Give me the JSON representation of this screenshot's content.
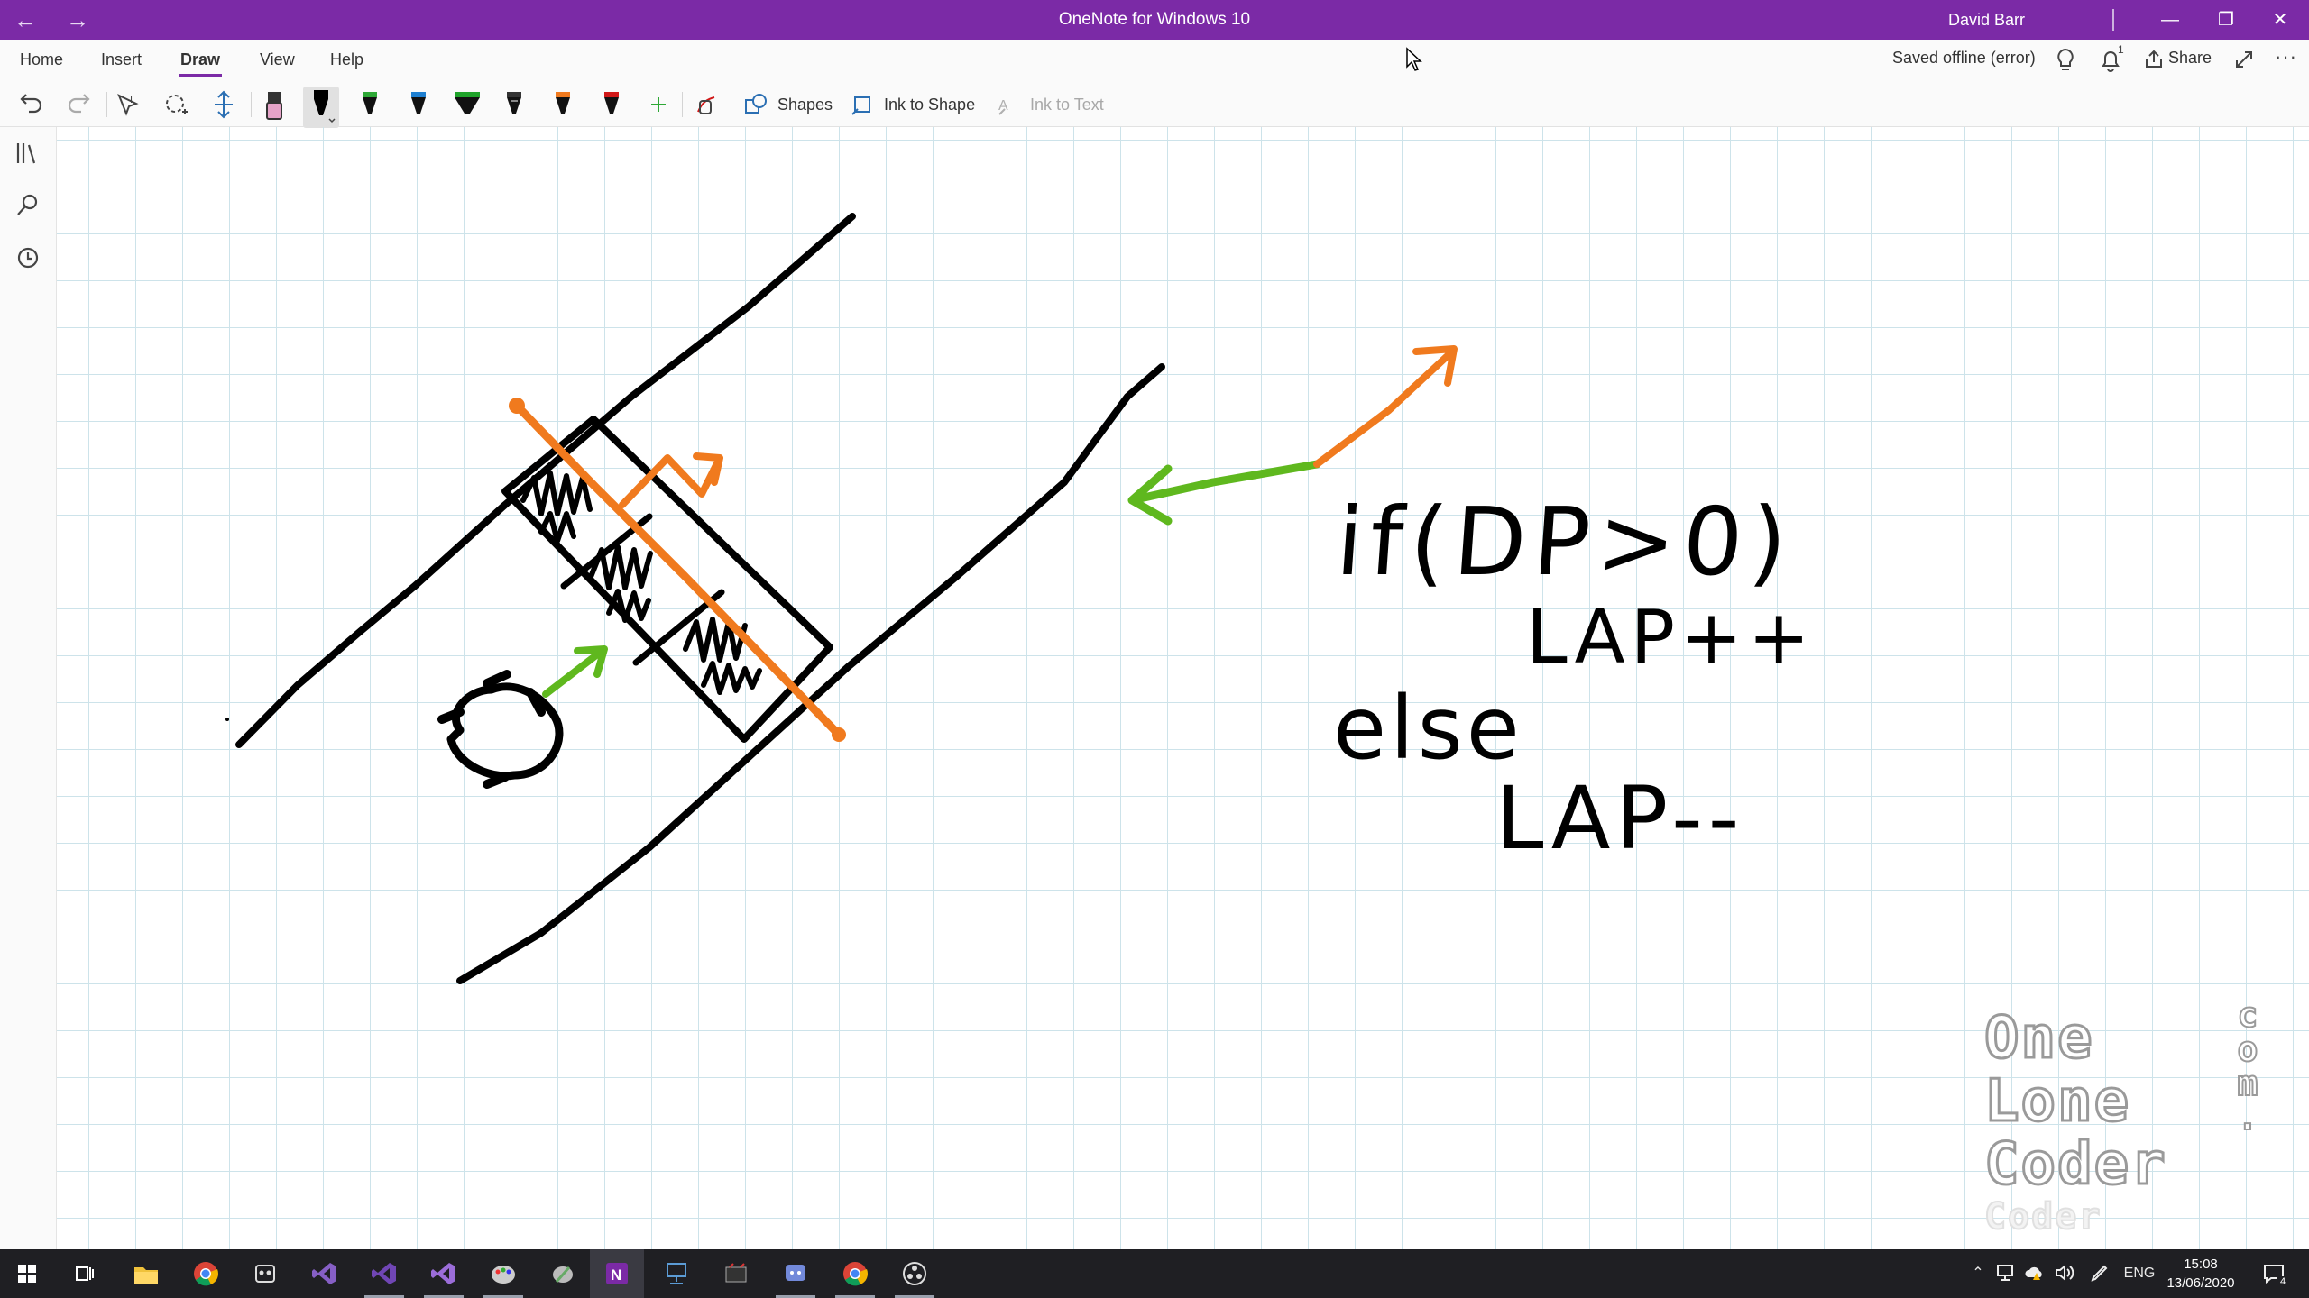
{
  "window": {
    "title": "OneNote for Windows 10",
    "user": "David Barr",
    "back_glyph": "←",
    "forward_glyph": "→",
    "minimize_glyph": "—",
    "restore_glyph": "❐",
    "close_glyph": "✕"
  },
  "menu": {
    "tabs": [
      {
        "label": "Home"
      },
      {
        "label": "Insert"
      },
      {
        "label": "Draw",
        "active": true
      },
      {
        "label": "View"
      },
      {
        "label": "Help"
      }
    ],
    "status": "Saved offline (error)",
    "notification_count": "1",
    "share_label": "Share"
  },
  "toolbar": {
    "shapes_label": "Shapes",
    "ink_to_shape_label": "Ink to Shape",
    "ink_to_text_label": "Ink to Text",
    "pen_colors": [
      "#e5a3c8",
      "#000000",
      "#2ea836",
      "#1e7fd0",
      "#1fa32a",
      "#333333",
      "#f07a1e",
      "#d01818"
    ]
  },
  "note": {
    "handwriting": [
      "if(DP>0)",
      "LAP++",
      "else",
      "LAP--"
    ]
  },
  "watermark": {
    "lines": [
      "One",
      "Lone",
      "Coder"
    ],
    "vertical": [
      "c",
      "o",
      "m"
    ],
    "dot": "."
  },
  "taskbar": {
    "tray_lang": "ENG",
    "time": "15:08",
    "date": "13/06/2020",
    "notifications_badge": "4"
  },
  "colors": {
    "title_bar": "#7b2aa6",
    "ink_black": "#000000",
    "ink_orange": "#f07a1e",
    "ink_green": "#5fb81e",
    "grid": "#cde3ea"
  }
}
